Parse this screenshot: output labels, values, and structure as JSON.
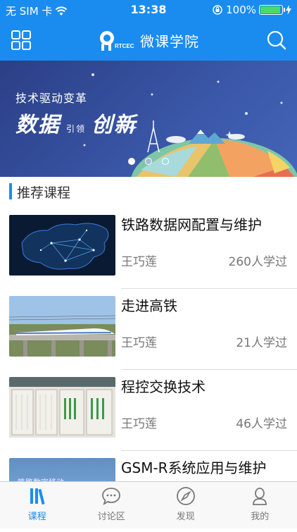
{
  "status_bar": {
    "carrier": "无 SIM 卡",
    "time": "13:38",
    "battery_text": "100%",
    "battery_level": 1.0
  },
  "navbar": {
    "logo_text": "RTCEC",
    "title": "微课学院"
  },
  "banner": {
    "subtitle": "技术驱动变革",
    "headline_left": "数据",
    "headline_mid": "引领",
    "headline_right": "创新",
    "slide_count": 3,
    "active_slide": 2
  },
  "section": {
    "title": "推荐课程"
  },
  "courses": [
    {
      "title": "铁路数据网配置与维护",
      "teacher": "王巧莲",
      "learners": "260人学过",
      "thumb": "china-network-map"
    },
    {
      "title": "走进高铁",
      "teacher": "王巧莲",
      "learners": "21人学过",
      "thumb": "high-speed-train"
    },
    {
      "title": "程控交换技术",
      "teacher": "王巧莲",
      "learners": "46人学过",
      "thumb": "switch-cabinet"
    },
    {
      "title": "GSM-R系统应用与维护",
      "teacher": "",
      "learners": "",
      "thumb": "railway-digital-mobile",
      "thumb_text": "铁路数字移动"
    }
  ],
  "tabbar": {
    "tabs": [
      {
        "label": "课程",
        "icon": "books-icon",
        "active": true
      },
      {
        "label": "讨论区",
        "icon": "chat-icon",
        "active": false
      },
      {
        "label": "发现",
        "icon": "compass-icon",
        "active": false
      },
      {
        "label": "我的",
        "icon": "user-icon",
        "active": false
      }
    ]
  },
  "colors": {
    "accent": "#1a8cf0",
    "inactive": "#777777"
  }
}
